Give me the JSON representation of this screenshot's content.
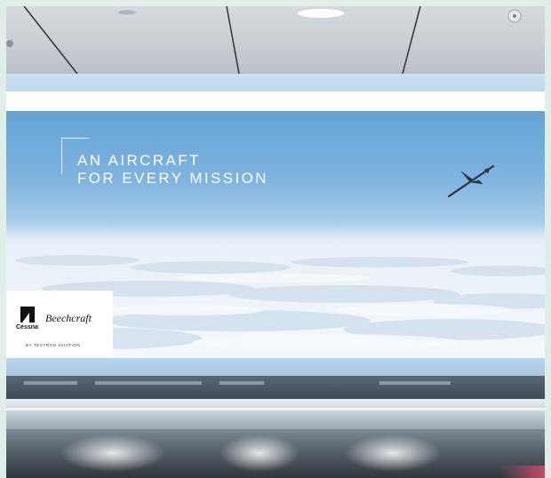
{
  "billboard": {
    "headline_line1": "AN AIRCRAFT",
    "headline_line2": "FOR EVERY MISSION"
  },
  "logo": {
    "cessna": "Cessna",
    "beechcraft": "Beechcraft",
    "tagline": "BY TEXTRON AVIATION"
  },
  "colors": {
    "sky_top": "#64a3d6",
    "cloud": "#e3ecf4",
    "ceiling": "#c9cfd4"
  }
}
